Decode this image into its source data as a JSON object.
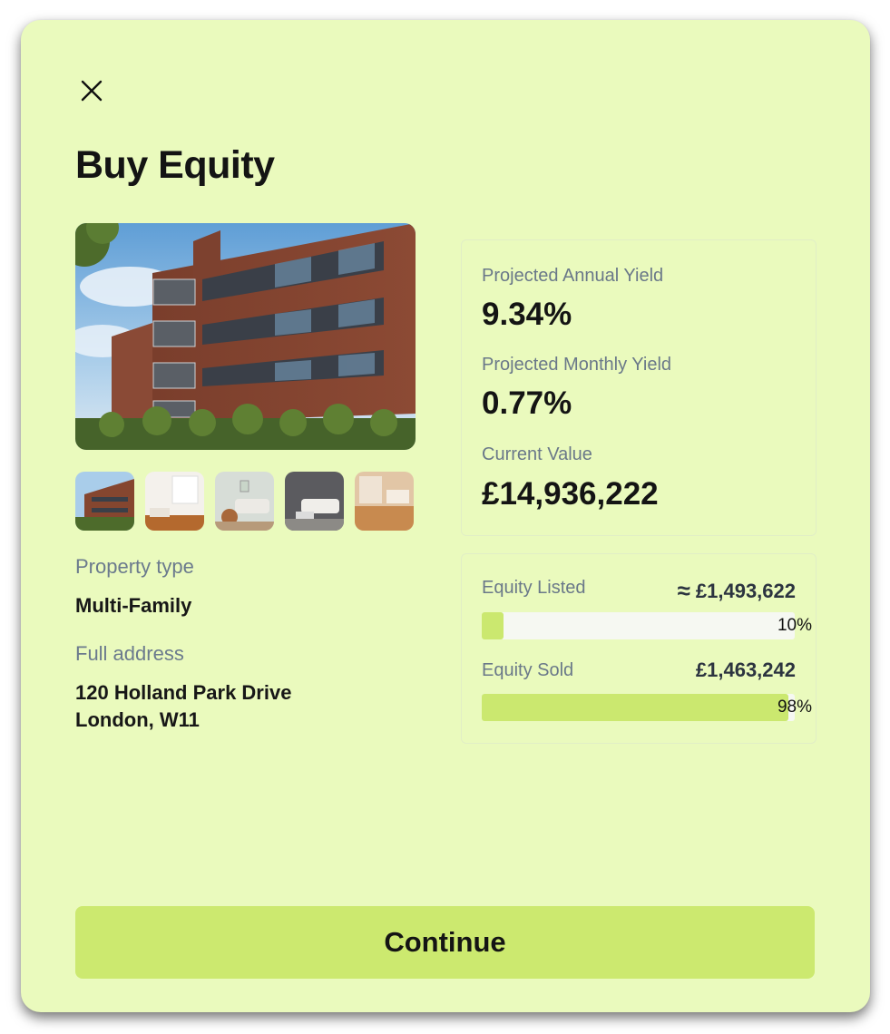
{
  "modal": {
    "title": "Buy Equity",
    "close_icon": "close-icon",
    "continue_label": "Continue"
  },
  "property": {
    "type_label": "Property type",
    "type_value": "Multi-Family",
    "address_label": "Full address",
    "address_line1": "120 Holland Park Drive",
    "address_line2": "London, W11",
    "thumbnails": [
      "exterior-thumbnail",
      "bedroom-thumbnail",
      "living-room-thumbnail",
      "lounge-thumbnail",
      "kitchen-thumbnail"
    ]
  },
  "stats": {
    "annual_label": "Projected Annual Yield",
    "annual_value": "9.34%",
    "monthly_label": "Projected Monthly Yield",
    "monthly_value": "0.77%",
    "current_label": "Current Value",
    "current_value": "£14,936,222"
  },
  "equity": {
    "listed_label": "Equity Listed",
    "listed_amount": "£1,493,622",
    "listed_approx_icon": "approx-icon",
    "listed_pct_text": "10%",
    "listed_fraction": 0.07,
    "sold_label": "Equity Sold",
    "sold_amount": "£1,463,242",
    "sold_pct_text": "98%",
    "sold_fraction": 0.98
  },
  "colors": {
    "background": "#eafabd",
    "accent": "#cce96f",
    "muted_text": "#6b7a8d"
  }
}
